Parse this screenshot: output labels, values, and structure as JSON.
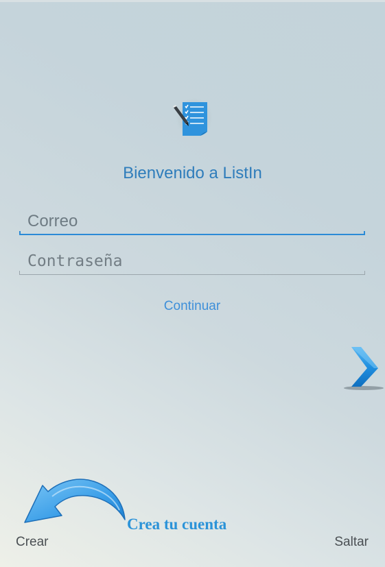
{
  "app": {
    "logo_icon": "checklist-note-icon",
    "welcome_title": "Bienvenido a ListIn"
  },
  "login": {
    "email_placeholder": "Correo",
    "email_value": "",
    "password_placeholder": "Contraseña",
    "password_value": "",
    "continue_label": "Continuar"
  },
  "navigation": {
    "next_icon": "chevron-right-icon",
    "hint_arrow_icon": "curved-arrow-icon",
    "create_hint": "Crea tu cuenta",
    "create_label": "Crear",
    "skip_label": "Saltar"
  },
  "colors": {
    "accent": "#2b8ad6",
    "title": "#2f7dbb",
    "link": "#3e8fd9",
    "hint": "#2b93d8",
    "footer_text": "#4a4f53"
  }
}
